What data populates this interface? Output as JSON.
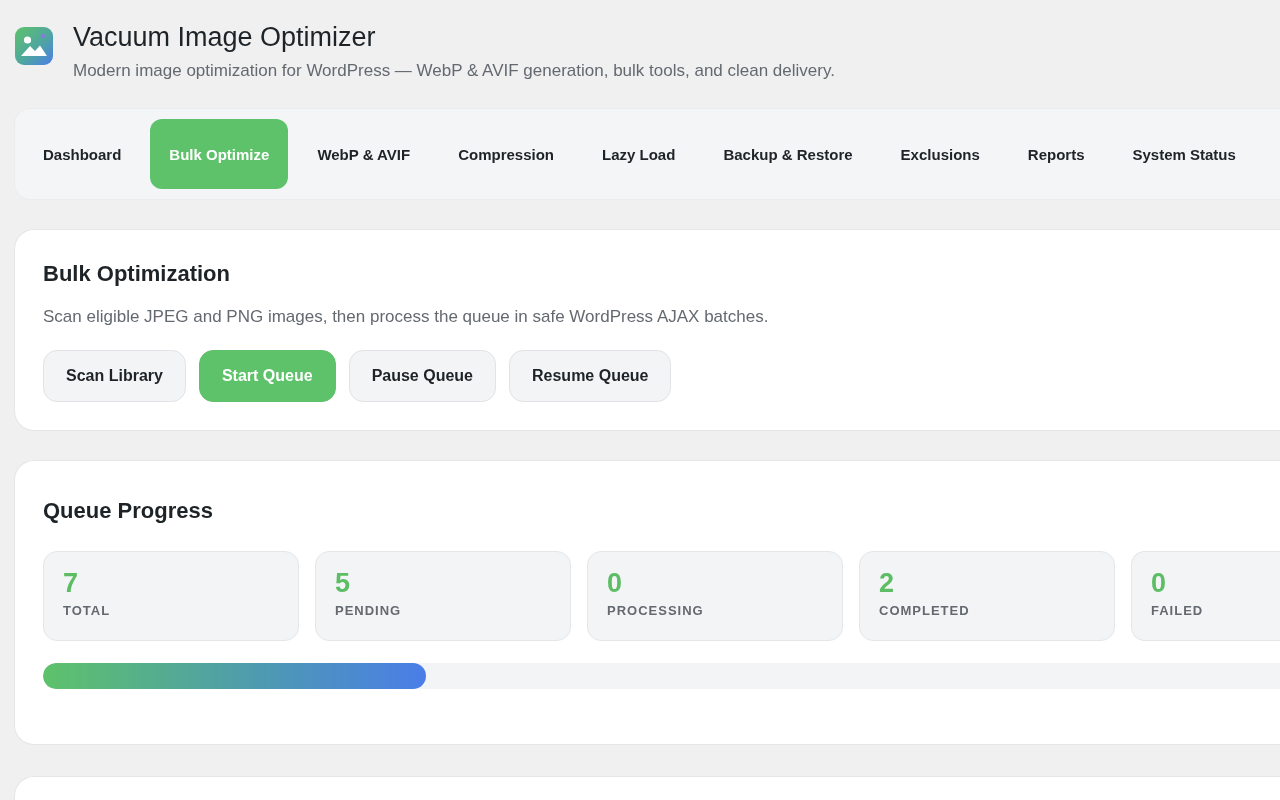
{
  "app": {
    "title": "Vacuum Image Optimizer",
    "subtitle": "Modern image optimization for WordPress — WebP & AVIF generation, bulk tools, and clean delivery."
  },
  "tabs": [
    {
      "label": "Dashboard",
      "selected": false
    },
    {
      "label": "Bulk Optimize",
      "selected": true
    },
    {
      "label": "WebP & AVIF",
      "selected": false
    },
    {
      "label": "Compression",
      "selected": false
    },
    {
      "label": "Lazy Load",
      "selected": false
    },
    {
      "label": "Backup & Restore",
      "selected": false
    },
    {
      "label": "Exclusions",
      "selected": false
    },
    {
      "label": "Reports",
      "selected": false
    },
    {
      "label": "System Status",
      "selected": false
    }
  ],
  "bulk_optimization": {
    "title": "Bulk Optimization",
    "description": "Scan eligible JPEG and PNG images, then process the queue in safe WordPress AJAX batches.",
    "buttons": [
      {
        "label": "Scan Library",
        "kind": "secondary"
      },
      {
        "label": "Start Queue",
        "kind": "primary"
      },
      {
        "label": "Pause Queue",
        "kind": "secondary"
      },
      {
        "label": "Resume Queue",
        "kind": "secondary"
      }
    ]
  },
  "queue_progress": {
    "title": "Queue Progress",
    "stats": [
      {
        "value": "7",
        "label": "TOTAL"
      },
      {
        "value": "5",
        "label": "PENDING"
      },
      {
        "value": "0",
        "label": "PROCESSING"
      },
      {
        "value": "2",
        "label": "COMPLETED"
      },
      {
        "value": "0",
        "label": "FAILED"
      }
    ],
    "progress": {
      "level": 0.31
    }
  }
}
